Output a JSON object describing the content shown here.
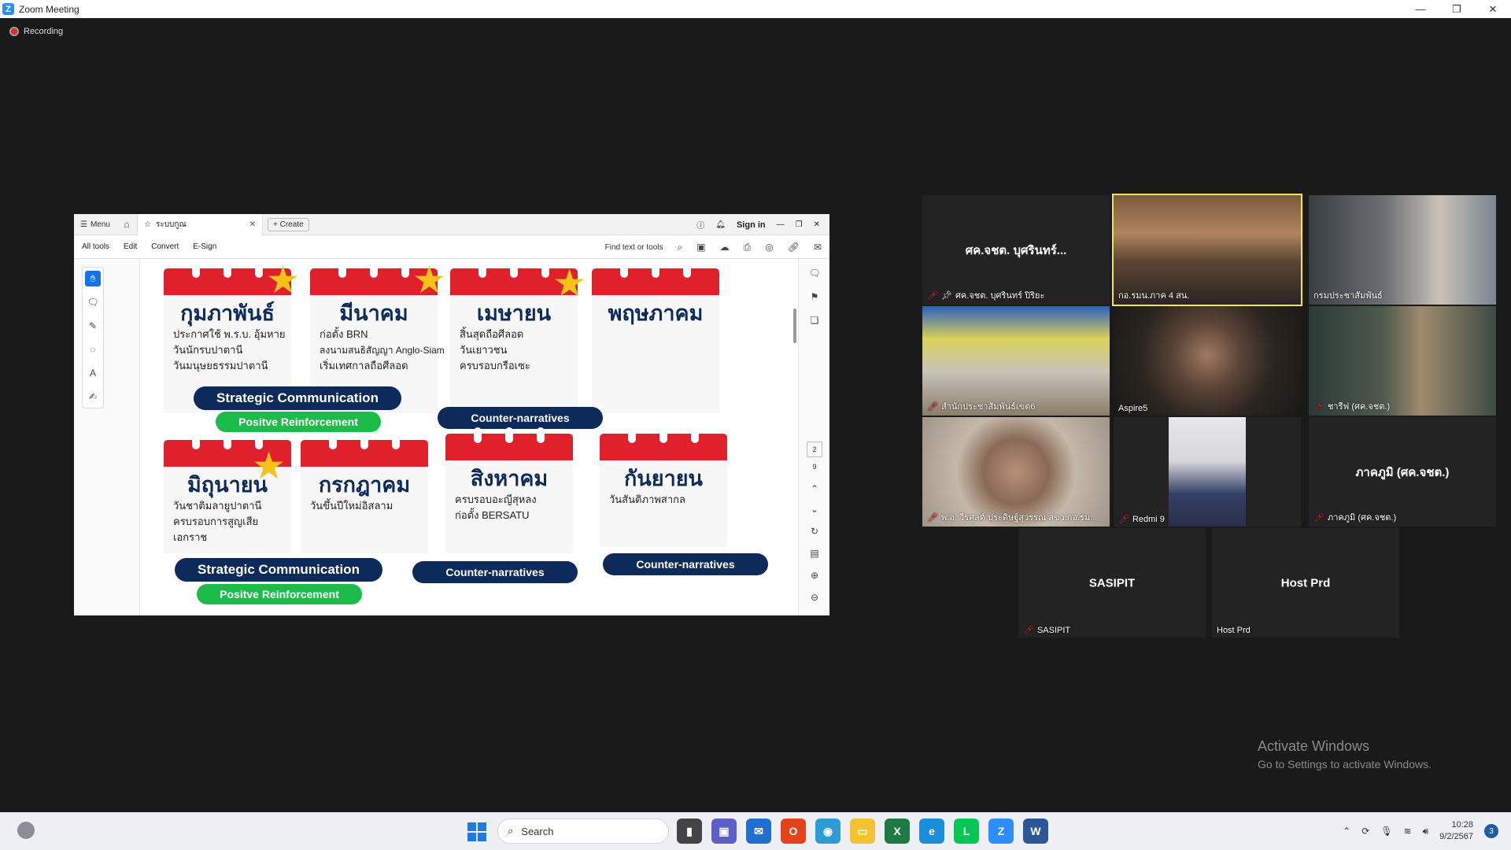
{
  "window": {
    "title": "Zoom Meeting",
    "minimize": "—",
    "restore": "❐",
    "close": "✕"
  },
  "recording": {
    "label": "Recording"
  },
  "pdf": {
    "menu_label": "Menu",
    "tab_title": "ระบบกูณ",
    "create_label": "Create",
    "sign_in": "Sign in",
    "toolbar_menus": [
      "All tools",
      "Edit",
      "Convert",
      "E-Sign"
    ],
    "find_label": "Find text or tools",
    "page_current": "2",
    "page_total": "9",
    "calendar_top": [
      {
        "month": "กุมภาพันธ์",
        "lines": [
          "ประกาศใช้ พ.ร.บ. อุ้มหาย",
          "วันนักรบปาตานี",
          "วันมนุษยธรรมปาตานี"
        ],
        "star": true
      },
      {
        "month": "มีนาคม",
        "lines": [
          "ก่อตั้ง BRN",
          "ลงนามสนธิสัญญา Anglo-Siam",
          "เริ่มเทศกาลถือศีลอด"
        ],
        "star": true
      },
      {
        "month": "เมษายน",
        "lines": [
          "สิ้นสุดถือศีลอด",
          "วันเยาวชน",
          "ครบรอบกรือเซะ"
        ],
        "star": true
      },
      {
        "month": "พฤษภาคม",
        "lines": [],
        "star": false
      }
    ],
    "calendar_bottom": [
      {
        "month": "มิถุนายน",
        "lines": [
          "วันชาติมลายูปาตานี",
          "ครบรอบการสูญเสีย",
          "เอกราช"
        ],
        "star": true
      },
      {
        "month": "กรกฎาคม",
        "lines": [
          "วันขึ้นปีใหม่อิสลาม"
        ],
        "star": false
      },
      {
        "month": "สิงหาคม",
        "lines": [
          "ครบรอบอะญีสุหลง",
          "ก่อตั้ง BERSATU"
        ],
        "star": false
      },
      {
        "month": "กันยายน",
        "lines": [
          "วันสันติภาพสากล"
        ],
        "star": false
      }
    ],
    "pills": {
      "strategic_1": "Strategic Communication",
      "positive_1": "Positve Reinforcement",
      "counter_1": "Counter-narratives",
      "strategic_2": "Strategic Communication",
      "positive_2": "Positve Reinforcement",
      "counter_2": "Counter-narratives",
      "counter_3": "Counter-narratives"
    }
  },
  "participants": [
    {
      "name": "ศค.จชต. บุศรินทร์ ปิริยะ",
      "display": "ศค.จชต. บุศรินทร์...",
      "video": false,
      "muted": true,
      "pinned": true
    },
    {
      "name": "กอ.รมน.ภาค 4 สน.",
      "display": "",
      "video": true,
      "muted": false,
      "speaking": true
    },
    {
      "name": "กรมประชาสัมพันธ์",
      "display": "",
      "video": true,
      "muted": false
    },
    {
      "name": "สำนักประชาสัมพันธ์เขต6",
      "display": "",
      "video": true,
      "muted": true
    },
    {
      "name": "Aspire5",
      "display": "",
      "video": true,
      "muted": false
    },
    {
      "name": "ชารีฟ (ศค.จชต.)",
      "display": "",
      "video": true,
      "muted": true
    },
    {
      "name": "พ.อ. วีรศุลต์ ประดิษฐ์สุวรรณ สขว.กอ.รม...",
      "display": "",
      "video": true,
      "muted": true
    },
    {
      "name": "Redmi 9",
      "display": "",
      "video": true,
      "muted": true
    },
    {
      "name": "ภาคภูมิ (ศค.จชต.)",
      "display": "ภาคภูมิ (ศค.จชต.)",
      "video": false,
      "muted": true
    },
    {
      "name": "SASIPIT",
      "display": "SASIPIT",
      "video": false,
      "muted": true
    },
    {
      "name": "Host Prd",
      "display": "Host Prd",
      "video": false,
      "muted": false
    }
  ],
  "watermark": {
    "line1": "Activate Windows",
    "line2": "Go to Settings to activate Windows."
  },
  "taskbar": {
    "search_label": "Search",
    "clock_time": "10:28",
    "clock_date": "9/2/2567",
    "notification_count": "3"
  }
}
